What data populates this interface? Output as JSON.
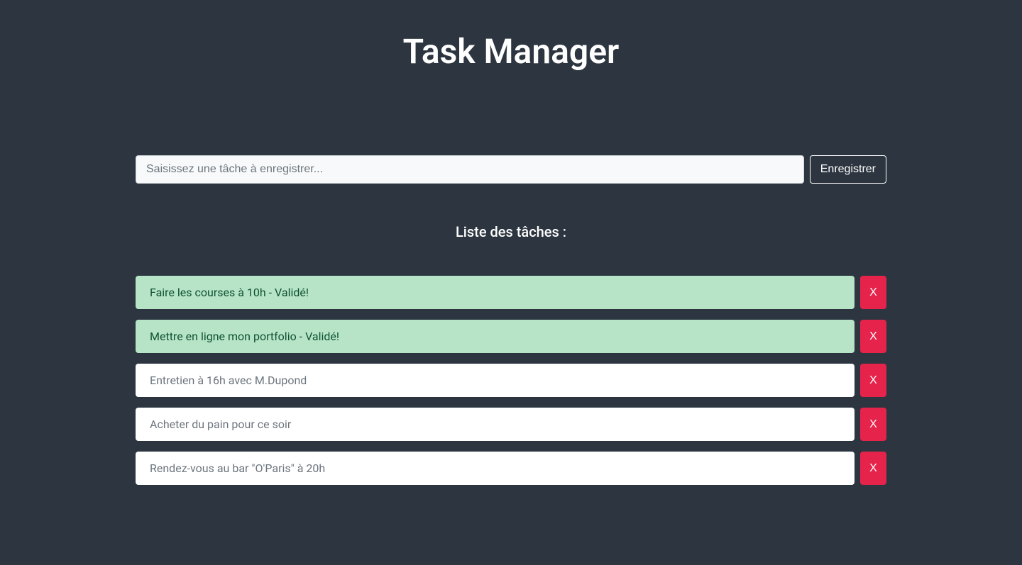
{
  "header": {
    "title": "Task Manager"
  },
  "input": {
    "placeholder": "Saisissez une tâche à enregistrer...",
    "button_label": "Enregistrer"
  },
  "list": {
    "heading": "Liste des tâches :",
    "delete_label": "X",
    "validated_suffix": " - Validé!",
    "tasks": [
      {
        "text": "Faire les courses à 10h - Validé!",
        "validated": true
      },
      {
        "text": "Mettre en ligne mon portfolio - Validé!",
        "validated": true
      },
      {
        "text": "Entretien à 16h avec M.Dupond",
        "validated": false
      },
      {
        "text": "Acheter du pain pour ce soir",
        "validated": false
      },
      {
        "text": "Rendez-vous au bar \"O'Paris\" à 20h",
        "validated": false
      }
    ]
  },
  "colors": {
    "background": "#2d3640",
    "text_light": "#ffffff",
    "input_bg": "#f8f9fa",
    "card_bg": "#ffffff",
    "card_text": "#6c757d",
    "validated_bg": "#b7e4c7",
    "validated_text": "#0f5132",
    "delete_bg": "#e6234a"
  }
}
